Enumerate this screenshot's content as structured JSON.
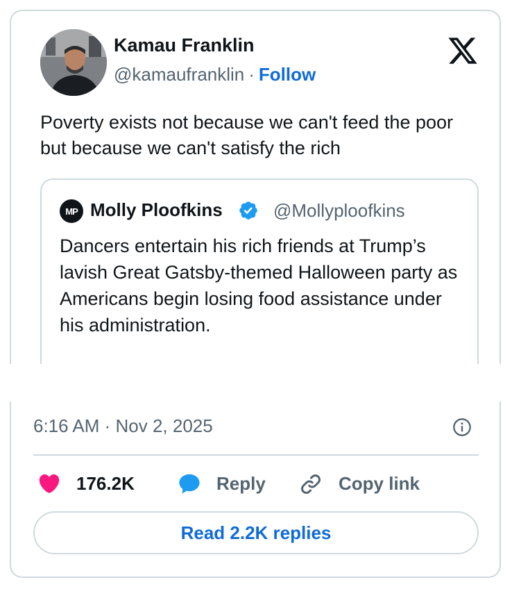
{
  "tweet": {
    "author_name": "Kamau Franklin",
    "author_handle": "@kamaufranklin",
    "separator": "·",
    "follow_label": "Follow",
    "text": "Poverty exists not because we can't feed the poor but because we can't satisfy the rich",
    "timestamp": "6:16 AM · Nov 2, 2025"
  },
  "quote": {
    "avatar_initials": "MP",
    "author_name": "Molly Ploofkins",
    "author_handle": "@Mollyploofkins",
    "text": "Dancers entertain his rich friends at Trump’s lavish Great Gatsby-themed Halloween party as Americans begin losing food assistance under his administration."
  },
  "actions": {
    "like_count": "176.2K",
    "reply_label": "Reply",
    "copy_link_label": "Copy link",
    "read_replies_label": "Read 2.2K replies"
  },
  "icons": {
    "brand": "x-logo-icon",
    "verified": "verified-badge-icon",
    "info": "info-icon",
    "like": "heart-icon",
    "reply": "reply-bubble-icon",
    "link": "link-icon"
  },
  "colors": {
    "link_blue": "#0f6bd6",
    "verified_blue": "#1d9bf0",
    "heart_pink": "#f91880",
    "muted_text": "#536471",
    "border": "#cfd9de"
  }
}
